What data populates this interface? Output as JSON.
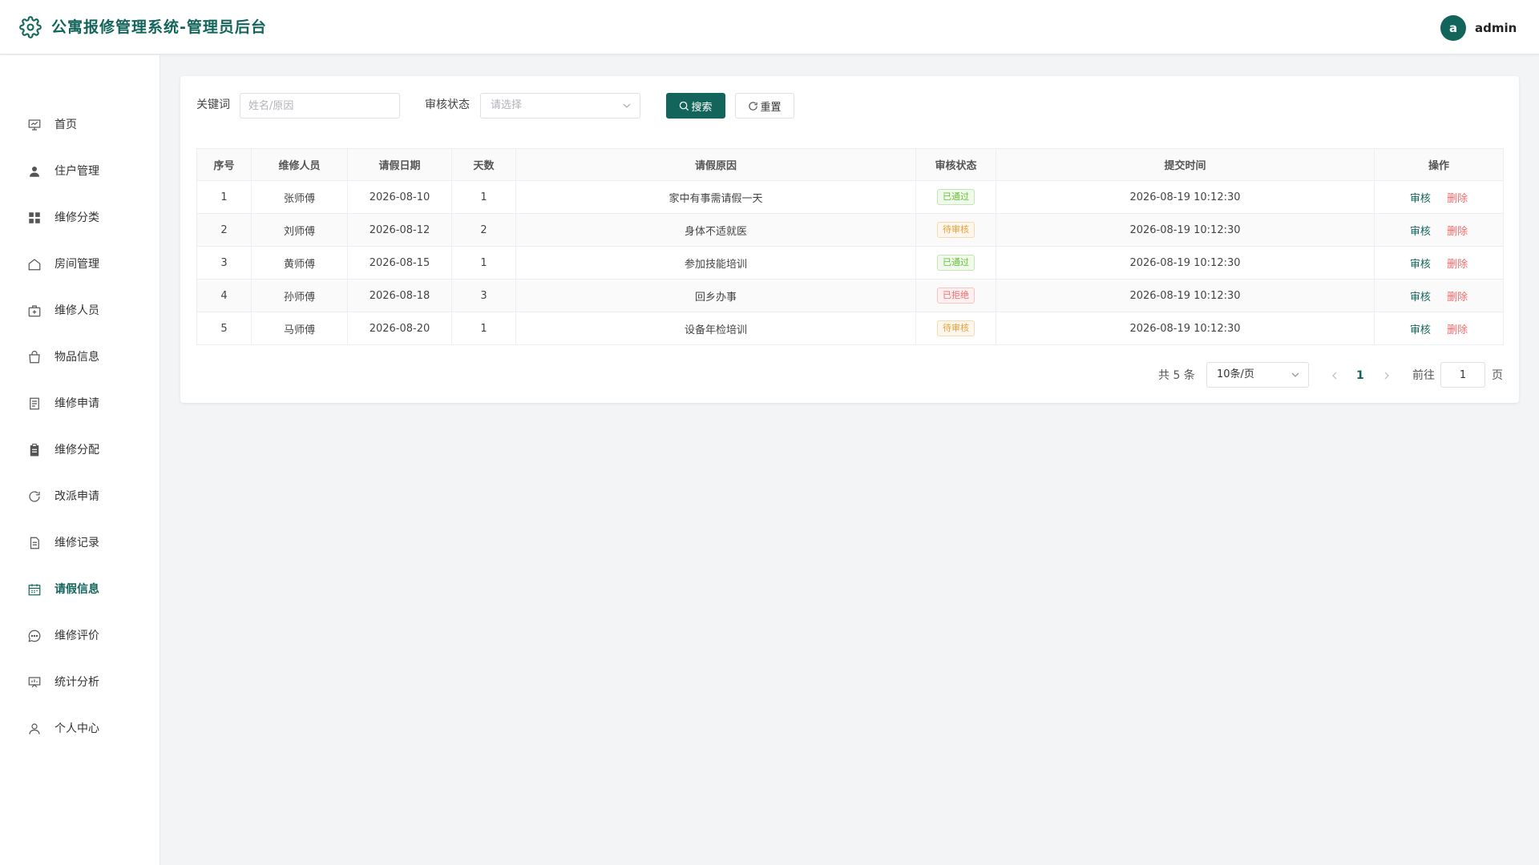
{
  "header": {
    "title": "公寓报修管理系统-管理员后台",
    "avatar_initial": "a",
    "username": "admin"
  },
  "colors": {
    "brand": "#13655c",
    "danger": "#f56c6c",
    "success": "#67c23a",
    "warning": "#e6a23c"
  },
  "sidebar": {
    "active_index": 11,
    "items": [
      {
        "label": "首页",
        "icon": "presentation-icon"
      },
      {
        "label": "住户管理",
        "icon": "user-filled-icon"
      },
      {
        "label": "维修分类",
        "icon": "grid-icon"
      },
      {
        "label": "房间管理",
        "icon": "house-icon"
      },
      {
        "label": "维修人员",
        "icon": "first-aid-kit-icon"
      },
      {
        "label": "物品信息",
        "icon": "shopping-bag-icon"
      },
      {
        "label": "维修申请",
        "icon": "document-icon"
      },
      {
        "label": "维修分配",
        "icon": "clipboard-icon"
      },
      {
        "label": "改派申请",
        "icon": "refresh-icon"
      },
      {
        "label": "维修记录",
        "icon": "document-lines-icon"
      },
      {
        "label": "请假信息",
        "icon": "calendar-icon"
      },
      {
        "label": "维修评价",
        "icon": "chat-icon"
      },
      {
        "label": "统计分析",
        "icon": "chart-board-icon"
      },
      {
        "label": "个人中心",
        "icon": "user-icon"
      }
    ]
  },
  "filters": {
    "keyword_label": "关键词",
    "keyword_placeholder": "姓名/原因",
    "keyword_value": "",
    "status_label": "审核状态",
    "status_placeholder": "请选择",
    "search_label": "搜索",
    "reset_label": "重置"
  },
  "table": {
    "columns": [
      "序号",
      "维修人员",
      "请假日期",
      "天数",
      "请假原因",
      "审核状态",
      "提交时间",
      "操作"
    ],
    "audit_label": "审核",
    "delete_label": "删除",
    "rows": [
      {
        "index": "1",
        "staff": "张师傅",
        "date": "2026-08-10",
        "days": "1",
        "reason": "家中有事需请假一天",
        "status": "已通过",
        "status_type": "pass",
        "submitted": "2026-08-19 10:12:30"
      },
      {
        "index": "2",
        "staff": "刘师傅",
        "date": "2026-08-12",
        "days": "2",
        "reason": "身体不适就医",
        "status": "待审核",
        "status_type": "wait",
        "submitted": "2026-08-19 10:12:30"
      },
      {
        "index": "3",
        "staff": "黄师傅",
        "date": "2026-08-15",
        "days": "1",
        "reason": "参加技能培训",
        "status": "已通过",
        "status_type": "pass",
        "submitted": "2026-08-19 10:12:30"
      },
      {
        "index": "4",
        "staff": "孙师傅",
        "date": "2026-08-18",
        "days": "3",
        "reason": "回乡办事",
        "status": "已拒绝",
        "status_type": "reject",
        "submitted": "2026-08-19 10:12:30"
      },
      {
        "index": "5",
        "staff": "马师傅",
        "date": "2026-08-20",
        "days": "1",
        "reason": "设备年检培训",
        "status": "待审核",
        "status_type": "wait",
        "submitted": "2026-08-19 10:12:30"
      }
    ]
  },
  "pagination": {
    "total_text": "共 5 条",
    "page_size": "10条/页",
    "current_page": "1",
    "goto_label": "前往",
    "goto_value": "1",
    "page_suffix": "页"
  }
}
